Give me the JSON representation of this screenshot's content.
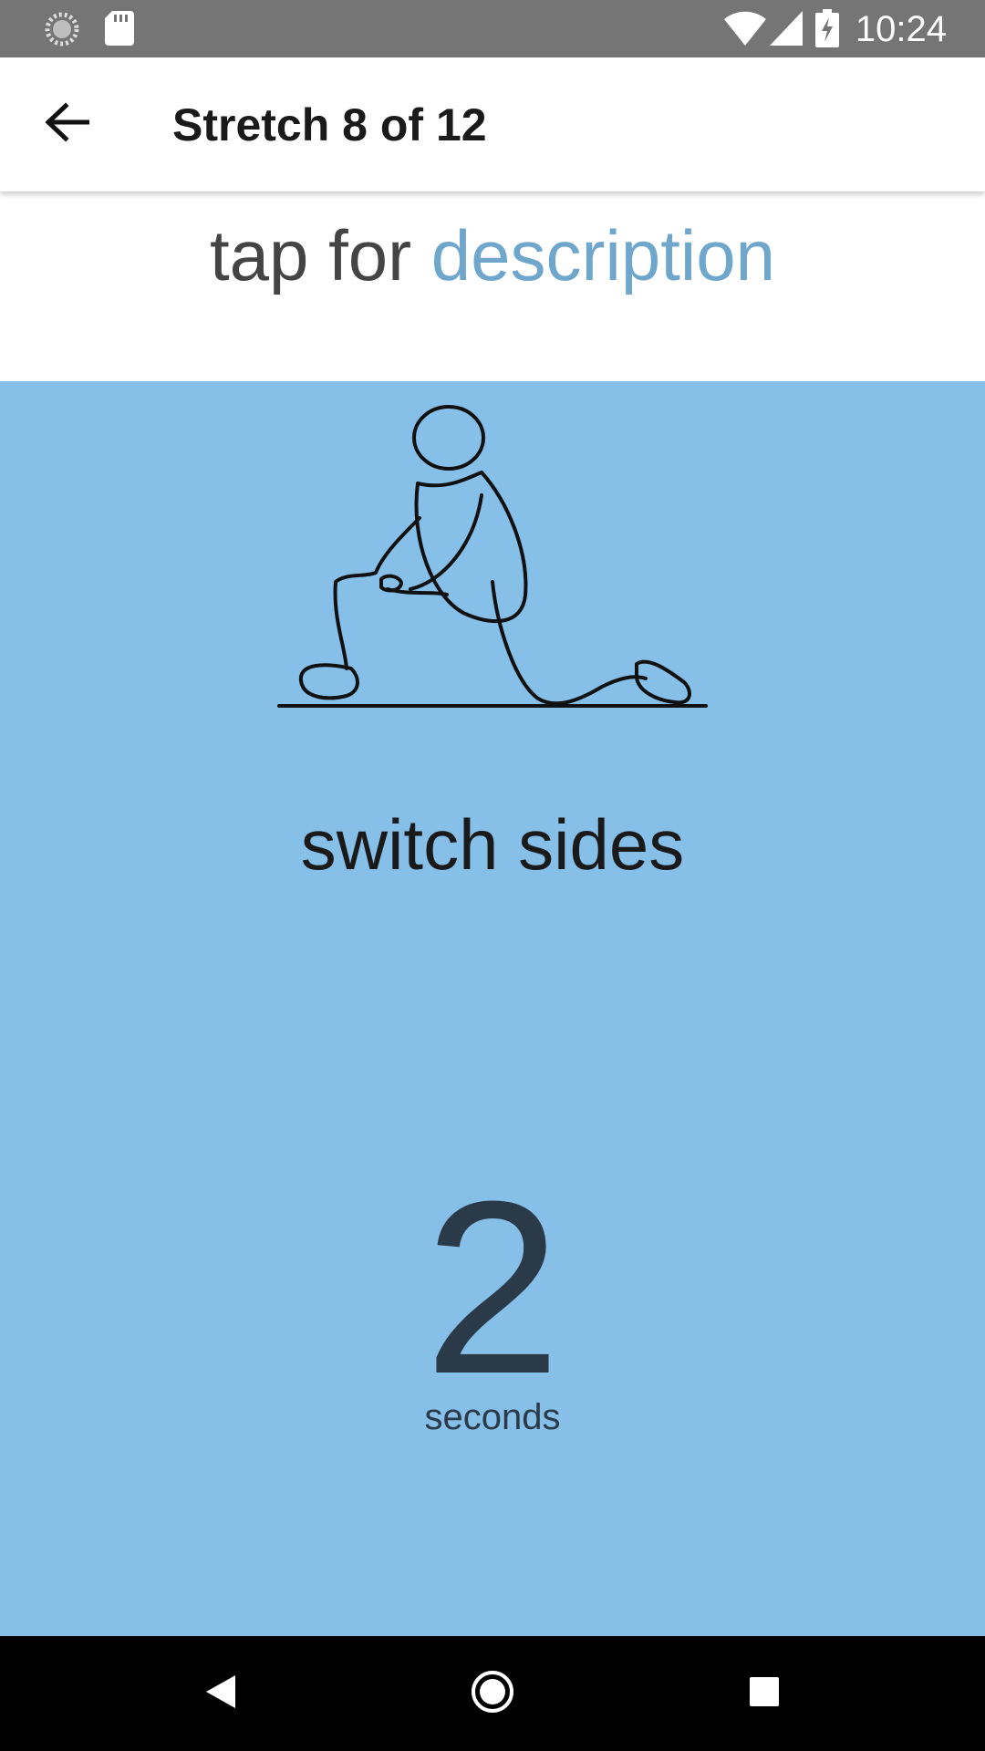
{
  "status_bar": {
    "time": "10:24",
    "left_icons": [
      "sync-icon",
      "sd-card-icon"
    ],
    "right_icons": [
      "wifi-icon",
      "cell-signal-icon",
      "battery-charging-icon"
    ]
  },
  "app_bar": {
    "title": "Stretch 8 of 12",
    "back_icon": "arrow-back-icon"
  },
  "description": {
    "prefix": "tap for ",
    "link": "description"
  },
  "stretch": {
    "illustration": "kneeling-lunge-stretch-illustration",
    "instruction": "switch sides",
    "countdown_value": "2",
    "countdown_unit": "seconds"
  },
  "nav_bar": {
    "buttons": [
      "back-triangle-icon",
      "home-circle-icon",
      "recents-square-icon"
    ]
  },
  "colors": {
    "status_bar": "#757575",
    "panel_bg": "#86bfe8",
    "link": "#6fa6cc",
    "countdown": "#2b3a48",
    "nav_bar": "#000000"
  }
}
